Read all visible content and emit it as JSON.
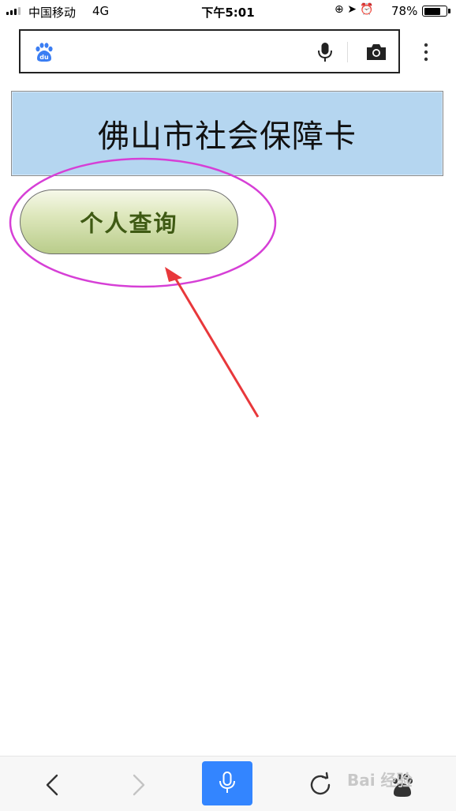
{
  "status_bar": {
    "carrier": "中国移动",
    "network": "4G",
    "time": "下午5:01",
    "battery": "78%",
    "battery_level": 0.78
  },
  "search": {
    "value": "",
    "logo_text": "du",
    "icons": [
      "baidu-paw-icon",
      "microphone-icon",
      "camera-icon",
      "more-vertical-icon"
    ]
  },
  "banner": {
    "title": "佛山市社会保障卡"
  },
  "query_button": {
    "label": "个人查询"
  },
  "annotation": {
    "highlight_color": "#d63fd6",
    "arrow_color": "#e8383b"
  },
  "bottom_nav": {
    "icons": [
      "back-icon",
      "forward-icon",
      "voice-search-icon",
      "refresh-icon",
      "baidu-home-icon"
    ],
    "accent": "#3385ff",
    "watermark": "Bai 经验"
  }
}
